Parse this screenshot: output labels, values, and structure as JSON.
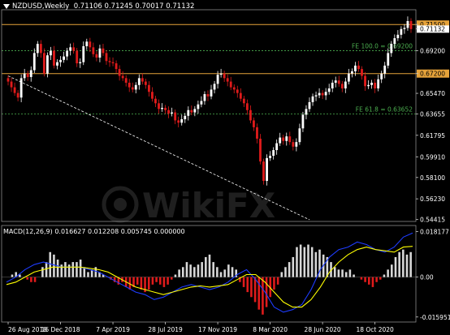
{
  "header": {
    "symbol": "NZDUSD,Weekly",
    "open": "0.71106",
    "high": "0.71245",
    "low": "0.70017",
    "close": "0.71132"
  },
  "macd_header": {
    "name": "MACD(12,26,9)",
    "v1": "0.016627",
    "v2": "0.012208",
    "v3": "0.005745",
    "v4": "0.000000"
  },
  "watermark": "WikiFX",
  "colors": {
    "background": "#000000",
    "bull": "#ffffff",
    "bear": "#e01b1b",
    "hline": "#e6a33a",
    "fib": "#4caf50",
    "grid": "#ffffff",
    "signal": "#ffff00",
    "macd_line": "#1e3cff",
    "hist_pos": "#d8d8d8",
    "hist_neg": "#e01b1b"
  },
  "chart_data": [
    {
      "type": "candlestick",
      "title": "NZDUSD,Weekly",
      "ylim": [
        0.5425,
        0.7265
      ],
      "y_ticks": [
        "0.71500",
        "0.71132",
        "0.69200",
        "0.67200",
        "0.65470",
        "0.63655",
        "0.61795",
        "0.59910",
        "0.58100",
        "0.56230",
        "0.54415"
      ],
      "x_ticks": [
        "26 Aug 2018",
        "16 Dec 2018",
        "7 Apr 2019",
        "28 Jul 2019",
        "17 Nov 2019",
        "8 Mar 2020",
        "28 Jun 2020",
        "18 Oct 2020"
      ],
      "horizontal_lines": [
        {
          "value": 0.715,
          "label": "0.71500",
          "style": "solid"
        },
        {
          "value": 0.672,
          "label": "0.67200",
          "style": "solid"
        }
      ],
      "fib_levels": [
        {
          "label": "FE 100.0 = 0.69200",
          "value": 0.692
        },
        {
          "label": "FE 61.8 = 0.63652",
          "value": 0.63652
        }
      ],
      "trendline": {
        "from": [
          0,
          0.67
        ],
        "to": [
          92,
          0.544
        ]
      },
      "closes": [
        0.665,
        0.66,
        0.655,
        0.651,
        0.668,
        0.672,
        0.669,
        0.675,
        0.69,
        0.698,
        0.69,
        0.672,
        0.688,
        0.692,
        0.679,
        0.682,
        0.684,
        0.687,
        0.692,
        0.695,
        0.692,
        0.681,
        0.682,
        0.696,
        0.7,
        0.695,
        0.689,
        0.686,
        0.694,
        0.69,
        0.683,
        0.682,
        0.681,
        0.676,
        0.67,
        0.668,
        0.664,
        0.66,
        0.658,
        0.662,
        0.668,
        0.665,
        0.662,
        0.656,
        0.65,
        0.646,
        0.641,
        0.642,
        0.64,
        0.637,
        0.638,
        0.631,
        0.629,
        0.632,
        0.635,
        0.64,
        0.638,
        0.641,
        0.645,
        0.648,
        0.654,
        0.652,
        0.658,
        0.663,
        0.671,
        0.672,
        0.668,
        0.665,
        0.66,
        0.658,
        0.655,
        0.65,
        0.646,
        0.64,
        0.631,
        0.625,
        0.615,
        0.595,
        0.578,
        0.598,
        0.6,
        0.605,
        0.611,
        0.616,
        0.613,
        0.617,
        0.612,
        0.608,
        0.612,
        0.624,
        0.636,
        0.641,
        0.647,
        0.652,
        0.653,
        0.655,
        0.653,
        0.656,
        0.659,
        0.664,
        0.666,
        0.663,
        0.659,
        0.665,
        0.672,
        0.674,
        0.679,
        0.676,
        0.67,
        0.661,
        0.662,
        0.664,
        0.659,
        0.667,
        0.672,
        0.679,
        0.69,
        0.698,
        0.703,
        0.706,
        0.711,
        0.712,
        0.718,
        0.711
      ]
    },
    {
      "type": "macd",
      "title": "MACD(12,26,9)",
      "ylim": [
        -0.01797,
        0.02063
      ],
      "y_ticks": [
        "0.018177",
        "0.00",
        "-0.015951"
      ],
      "histogram": [
        0.0,
        0.001,
        0.002,
        0.001,
        0.0,
        -0.001,
        -0.002,
        -0.002,
        0.0,
        0.004,
        0.006,
        0.01,
        0.009,
        0.007,
        0.005,
        0.006,
        0.005,
        0.006,
        0.006,
        0.007,
        0.004,
        0.002,
        0.003,
        0.004,
        0.002,
        0.001,
        0.0,
        -0.001,
        -0.002,
        -0.003,
        -0.002,
        -0.004,
        -0.005,
        -0.004,
        -0.003,
        -0.005,
        -0.006,
        -0.005,
        -0.003,
        -0.002,
        -0.003,
        -0.004,
        -0.003,
        -0.001,
        0.001,
        0.003,
        0.004,
        0.006,
        0.005,
        0.004,
        0.005,
        0.006,
        0.008,
        0.009,
        0.006,
        0.004,
        0.002,
        0.003,
        0.005,
        0.004,
        0.003,
        -0.002,
        -0.004,
        -0.006,
        -0.008,
        -0.01,
        -0.013,
        -0.015,
        -0.012,
        -0.008,
        -0.005,
        -0.003,
        0.002,
        0.004,
        0.006,
        0.008,
        0.012,
        0.013,
        0.012,
        0.013,
        0.012,
        0.01,
        0.011,
        0.009,
        0.008,
        0.006,
        0.004,
        0.003,
        0.003,
        0.002,
        0.003,
        0.001,
        0.0,
        -0.001,
        -0.002,
        -0.003,
        -0.004,
        -0.002,
        -0.001,
        0.001,
        0.003,
        0.005,
        0.008,
        0.01,
        0.011,
        0.009,
        0.01
      ],
      "macd_line": [
        -0.002,
        0.0,
        0.003,
        0.005,
        0.006,
        0.005,
        0.004,
        0.004,
        0.004,
        0.003,
        0.002,
        0.0,
        -0.002,
        -0.004,
        -0.006,
        -0.007,
        -0.009,
        -0.008,
        -0.006,
        -0.004,
        -0.003,
        -0.004,
        -0.005,
        -0.004,
        -0.002,
        0.001,
        0.003,
        -0.001,
        -0.006,
        -0.012,
        -0.014,
        -0.013,
        -0.011,
        -0.005,
        0.003,
        0.008,
        0.011,
        0.012,
        0.014,
        0.013,
        0.011,
        0.01,
        0.012,
        0.016,
        0.0176
      ],
      "signal_line": [
        -0.003,
        -0.002,
        0.0,
        0.002,
        0.003,
        0.004,
        0.004,
        0.004,
        0.004,
        0.0035,
        0.003,
        0.002,
        0.0,
        -0.002,
        -0.004,
        -0.005,
        -0.006,
        -0.007,
        -0.006,
        -0.005,
        -0.004,
        -0.0035,
        -0.004,
        -0.0035,
        -0.003,
        -0.001,
        0.001,
        0.001,
        -0.002,
        -0.006,
        -0.01,
        -0.012,
        -0.012,
        -0.009,
        -0.004,
        0.002,
        0.006,
        0.009,
        0.011,
        0.012,
        0.011,
        0.0105,
        0.01,
        0.012,
        0.0123
      ]
    }
  ]
}
